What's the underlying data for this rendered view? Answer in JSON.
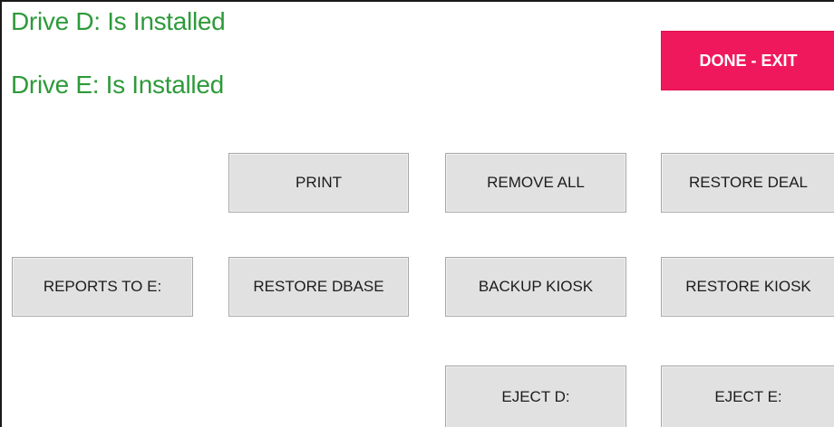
{
  "status": {
    "drive_d": "Drive D: Is Installed",
    "drive_e": "Drive E: Is Installed"
  },
  "buttons": {
    "done_exit": "DONE - EXIT",
    "print": "PRINT",
    "remove_all": "REMOVE ALL",
    "restore_deal": "RESTORE DEAL",
    "reports_to_e": "REPORTS TO E:",
    "restore_dbase": "RESTORE DBASE",
    "backup_kiosk": "BACKUP KIOSK",
    "restore_kiosk": "RESTORE KIOSK",
    "eject_d": "EJECT D:",
    "eject_e": "EJECT E:"
  },
  "colors": {
    "status_text": "#2e9a3a",
    "exit_button": "#f0185c",
    "button_face": "#e1e1e1"
  }
}
